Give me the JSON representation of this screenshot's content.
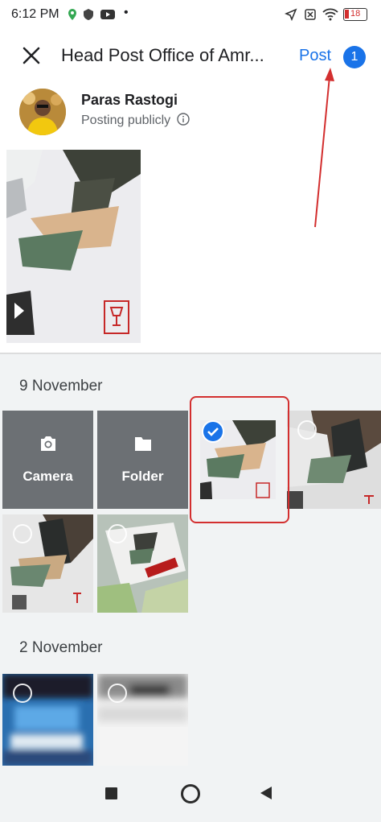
{
  "status_bar": {
    "time": "6:12 PM",
    "battery": "18"
  },
  "header": {
    "title": "Head Post Office of Amr...",
    "post_label": "Post",
    "count_badge": "1"
  },
  "user": {
    "name": "Paras Rastogi",
    "visibility": "Posting publicly"
  },
  "gallery": {
    "sections": [
      {
        "date": "9 November"
      },
      {
        "date": "2 November"
      }
    ],
    "camera_label": "Camera",
    "folder_label": "Folder"
  },
  "colors": {
    "accent": "#1a73e8",
    "highlight": "#d32f2f",
    "tile_gray": "#6c7074"
  },
  "icons": [
    "close-icon",
    "info-icon",
    "camera-icon",
    "folder-icon",
    "check-icon",
    "recents-icon",
    "home-icon",
    "back-icon"
  ]
}
